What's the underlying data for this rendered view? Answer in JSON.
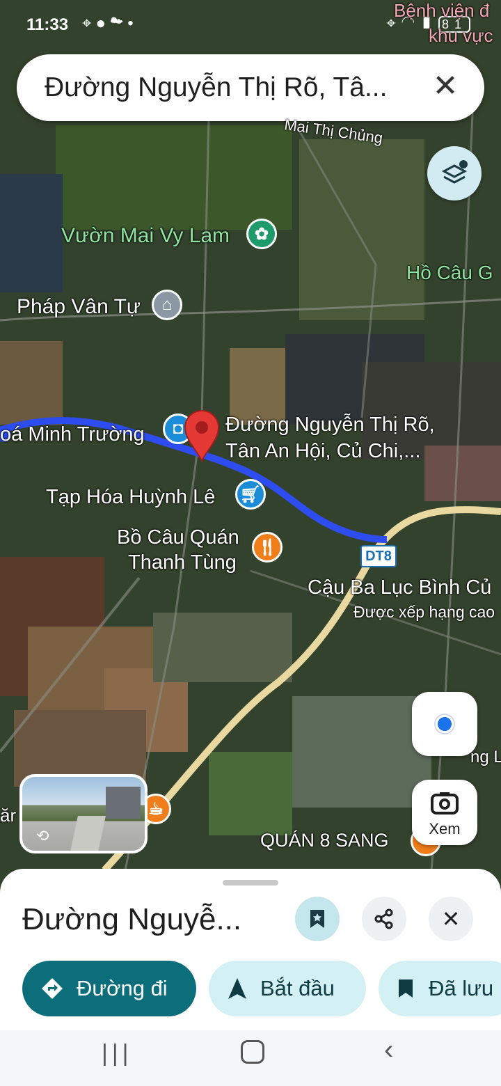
{
  "status_bar": {
    "time": "11:33",
    "left_icons": [
      "location-icon",
      "chat-icon",
      "cloud-icon",
      "dot-icon"
    ],
    "right_icons": [
      "location-icon",
      "wifi-icon",
      "signal-icon",
      "battery-icon"
    ],
    "battery": "81"
  },
  "search": {
    "query": "Đường Nguyễn Thị Rõ, Tâ...",
    "close_icon": "close-icon"
  },
  "map": {
    "type": "satellite",
    "route_color": "#2d4df0",
    "highway_color": "#e9d8a0",
    "labels": {
      "hospital": "Bệnh viện đ",
      "hospital_2": "khu vực",
      "mai_thi_chung": "Mai Thị Chủng",
      "vuon_mai": "Vườn Mai Vy Lam",
      "ho_cau": "Hồ Câu G",
      "phap_van": "Pháp Vân Tự",
      "minh_truong": "oá Minh Trường",
      "pin_line1": "Đường Nguyễn Thị Rõ,",
      "pin_line2": "Tân An Hội, Củ Chi,...",
      "huynh_le": "Tạp Hóa Huỳnh Lê",
      "bo_cau_1": "Bồ Câu Quán",
      "bo_cau_2": "Thanh Tùng",
      "dt8": "DT8",
      "cau_ba": "Cậu Ba Lục Bình Củ",
      "xep_hang": "Được xếp hạng cao",
      "quan_8": "QUÁN 8 SANG",
      "edge_left": "ăr",
      "edge_right": "ng L"
    }
  },
  "controls": {
    "layers_icon": "layers-icon",
    "location_icon": "my-location-icon",
    "lens_label": "Xem"
  },
  "sheet": {
    "title": "Đường Nguyễ...",
    "buttons": {
      "save_icon": "bookmark-icon",
      "share_icon": "share-icon",
      "close_icon": "close-icon"
    },
    "chips": {
      "directions": "Đường đi",
      "start": "Bắt đầu",
      "saved": "Đã lưu"
    }
  },
  "nav_bar": [
    "recents-icon",
    "home-icon",
    "back-icon"
  ]
}
